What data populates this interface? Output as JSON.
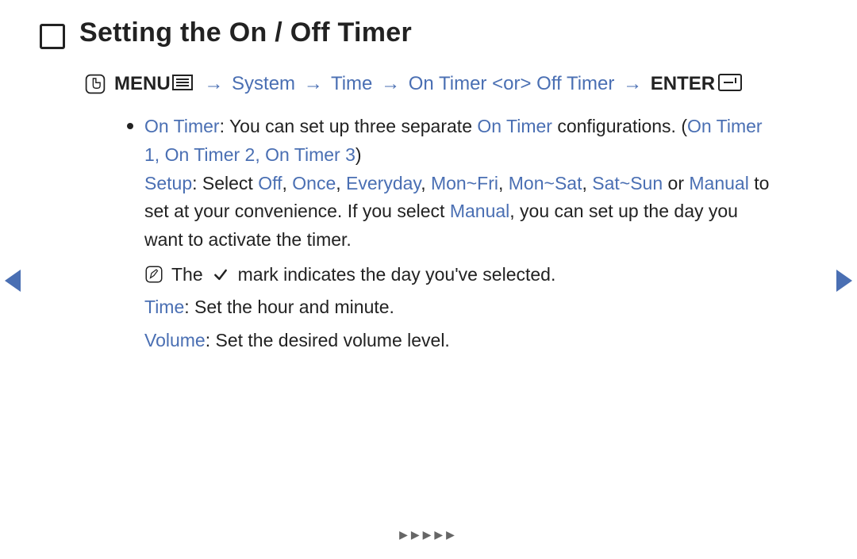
{
  "heading": "Setting the On / Off Timer",
  "path": {
    "menu_label": "MENU",
    "arrow": "→",
    "system": "System",
    "time": "Time",
    "on_timer": "On Timer",
    "or": "<or>",
    "off_timer": "Off Timer",
    "enter_label": "ENTER"
  },
  "on_timer": {
    "label": "On Timer",
    "desc1": ": You can set up three separate ",
    "on_timer_word": "On Timer",
    "desc2": " configurations. (",
    "list": "On Timer 1",
    "sep1": ", ",
    "list2": "On Timer 2",
    "sep2": ", ",
    "list3": "On Timer 3",
    "close": ")"
  },
  "setup": {
    "label": "Setup",
    "text1": ": Select ",
    "off": "Off",
    "c1": ", ",
    "once": "Once",
    "c2": ", ",
    "everyday": "Everyday",
    "c3": ", ",
    "monfri": "Mon~Fri",
    "c4": ", ",
    "monsat": "Mon~Sat",
    "c5": ", ",
    "satsun": "Sat~Sun",
    "or": " or ",
    "manual": "Manual",
    "text2": " to set at your convenience. If you select ",
    "manual2": "Manual",
    "text3": ", you can set up the day you want to activate the timer."
  },
  "note": {
    "pre": "The",
    "post": "mark indicates the day you've selected."
  },
  "time": {
    "label": "Time",
    "text": ": Set the hour and minute."
  },
  "volume": {
    "label": "Volume",
    "text": ": Set the desired volume level."
  },
  "footer": "▶▶▶▶▶"
}
